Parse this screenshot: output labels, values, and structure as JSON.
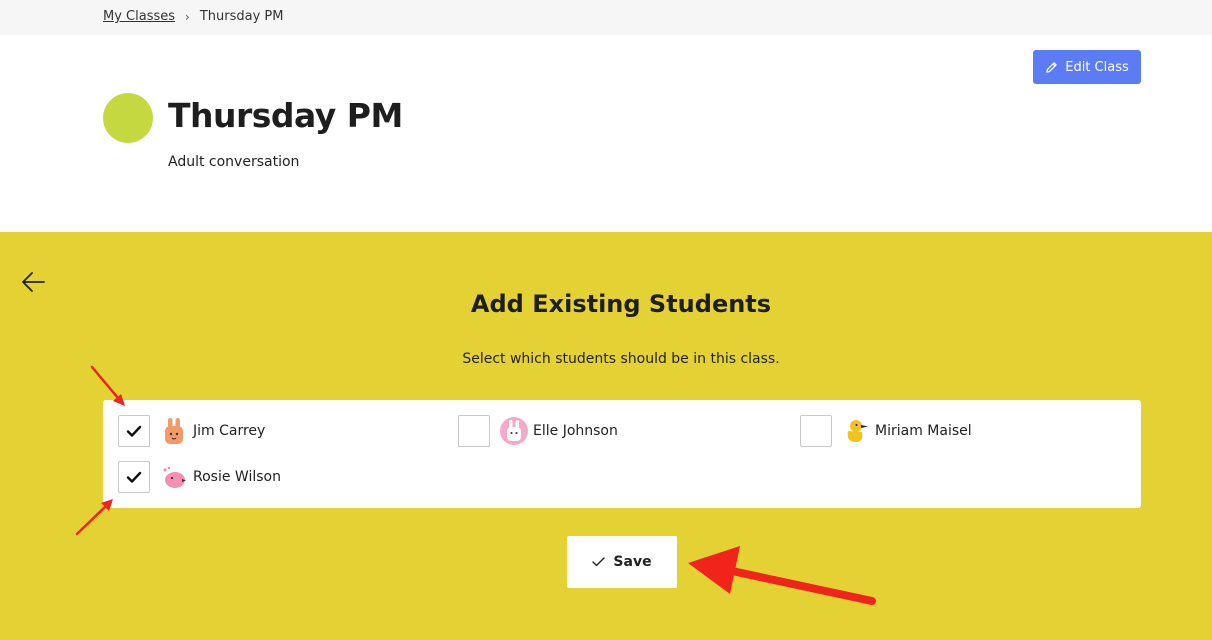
{
  "breadcrumb": {
    "parent": "My Classes",
    "current": "Thursday PM"
  },
  "header": {
    "edit_button": "Edit Class",
    "class_title": "Thursday PM",
    "class_subtitle": "Adult conversation",
    "class_color": "#c6d840"
  },
  "panel": {
    "title": "Add Existing Students",
    "subtitle": "Select which students should be in this class.",
    "background": "#e4d235",
    "students": [
      {
        "name": "Jim Carrey",
        "checked": true,
        "avatar": "orange-bunny-icon"
      },
      {
        "name": "Elle Johnson",
        "checked": false,
        "avatar": "pink-bunny-icon"
      },
      {
        "name": "Miriam Maisel",
        "checked": false,
        "avatar": "yellow-duck-icon"
      },
      {
        "name": "Rosie Wilson",
        "checked": true,
        "avatar": "pink-bird-icon"
      }
    ],
    "save_button": "Save"
  },
  "colors": {
    "accent": "#5b7cf5",
    "annotation": "#f0241b"
  }
}
